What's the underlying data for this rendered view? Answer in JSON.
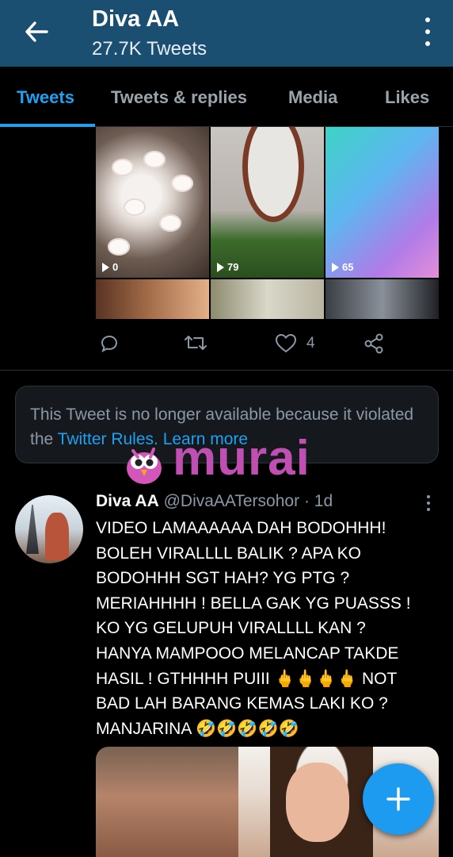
{
  "header": {
    "title": "Diva AA",
    "subtitle": "27.7K Tweets",
    "back_icon": "arrow-left-icon",
    "menu_icon": "more-vertical-icon",
    "background": "#1b4f72"
  },
  "tabs": [
    {
      "label": "Tweets",
      "active": true
    },
    {
      "label": "Tweets & replies",
      "active": false
    },
    {
      "label": "Media",
      "active": false
    },
    {
      "label": "Likes",
      "active": false
    }
  ],
  "media_tweet": {
    "media_views": [
      "0",
      "79",
      "65"
    ],
    "actions": {
      "reply_count": "",
      "retweet_count": "",
      "like_count": "4",
      "share_icon": "share-icon"
    }
  },
  "notice": {
    "text": "This Tweet is no longer available because it violated the ",
    "link1": "Twitter Rules.",
    "link2": "Learn more"
  },
  "watermark": {
    "text": "murai"
  },
  "tweet": {
    "name": "Diva AA",
    "handle": "@DivaAATersohor",
    "dot": "·",
    "time": "1d",
    "body": "VIDEO LAMAAAAAA DAH BODOHHH!\nBOLEH VIRALLLL BALIK ? APA KO\nBODOHHH SGT HAH? YG PTG ?\nMERIAHHHH ! BELLA GAK YG PUASSS !\nKO YG GELUPUH VIRALLLL KAN ?\nHANYA MAMPOOO MELANCAP TAKDE\nHASIL ! GTHHHH PUIII 🖕🖕🖕🖕 NOT\nBAD LAH BARANG KEMAS LAKI KO ?\nMANJARINA 🤣🤣🤣🤣🤣"
  },
  "fab": {
    "icon": "plus-icon",
    "color": "#1d9bf0"
  }
}
